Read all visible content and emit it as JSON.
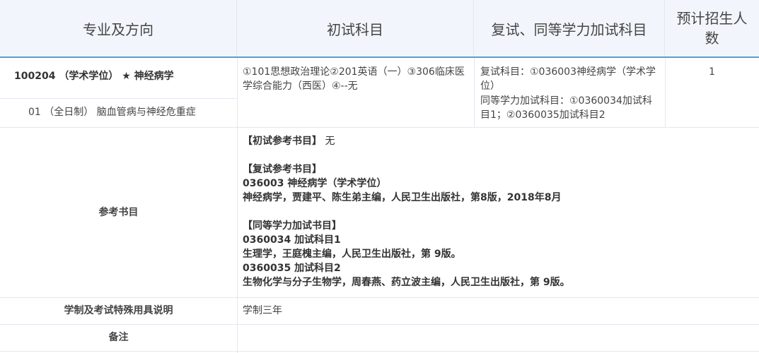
{
  "header": {
    "col1": "专业及方向",
    "col2": "初试科目",
    "col3": "复试、同等学力加试科目",
    "col4_line1": "预计招生人",
    "col4_line2": "数"
  },
  "row1": {
    "major": "100204 （学术学位） ★ 神经病学",
    "direction": "01 （全日制） 脑血管病与神经危重症",
    "exam_subjects": "①101思想政治理论②201英语（一）③306临床医学综合能力（西医）④--无",
    "retest_subjects": "复试科目：①036003神经病学（学术学位）",
    "extra_subjects": "同等学力加试科目：①0360034加试科目1；②0360035加试科目2",
    "enrollment": "1"
  },
  "references": {
    "label": "参考书目",
    "initial_title": "【初试参考书目】",
    "initial_value": "无",
    "retest_title": "【复试参考书目】",
    "retest_subject": "036003 神经病学（学术学位）",
    "retest_book": "神经病学，贾建平、陈生弟主编，人民卫生出版社，第8版，2018年8月",
    "extra_title": "【同等学力加试书目】",
    "extra_subject1": "0360034 加试科目1",
    "extra_book1": "生理学，王庭槐主编，人民卫生出版社，第 9版。",
    "extra_subject2": "0360035 加试科目2",
    "extra_book2": "生物化学与分子生物学，周春燕、药立波主编，人民卫生出版社，第 9版。"
  },
  "system": {
    "label": "学制及考试特殊用具说明",
    "value": "学制三年"
  },
  "remarks": {
    "label": "备注",
    "value": ""
  },
  "colors": {
    "header_bg": "#f2f6fc",
    "header_accent": "#4aa3d6",
    "border": "#e2e8ef"
  }
}
